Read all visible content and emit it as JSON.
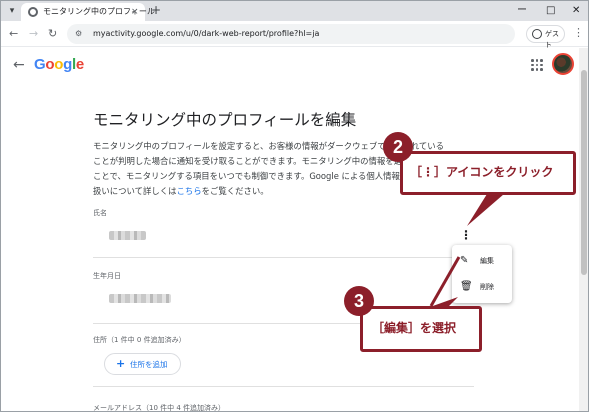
{
  "browser": {
    "tab_title": "モニタリング中のプロフィール",
    "tab_close": "×",
    "new_tab": "+",
    "url": "myactivity.google.com/u/0/dark-web-report/profile?hl=ja",
    "guest_label": "ゲスト",
    "window_controls": [
      "ー",
      "□",
      "✕"
    ]
  },
  "header": {
    "logo_letters": [
      {
        "ch": "G",
        "color": "#4285f4"
      },
      {
        "ch": "o",
        "color": "#ea4335"
      },
      {
        "ch": "o",
        "color": "#fbbc05"
      },
      {
        "ch": "g",
        "color": "#4285f4"
      },
      {
        "ch": "l",
        "color": "#34a853"
      },
      {
        "ch": "e",
        "color": "#ea4335"
      }
    ]
  },
  "main": {
    "title": "モニタリング中のプロフィールを編集",
    "description_lines": [
      "モニタリング中のプロフィールを設定すると、お客様の情報がダークウェブで公開されている",
      "ことが判明した場合に通知を受け取ることができます。モニタリング中の情報を選択する",
      "ことで、モニタリングする項目をいつでも制御できます。Google による個人情報の取り",
      "扱いについて詳しくは"
    ],
    "description_link": "こちら",
    "description_tail": "をご覧ください。",
    "fields": {
      "name_label": "氏名",
      "birthday_label": "生年月日",
      "address_label": "住所（1 件中 0 件追加済み）",
      "add_address_label": "住所を追加",
      "email_label": "メールアドレス（10 件中 4 件追加済み）"
    }
  },
  "context_menu": {
    "edit_label": "編集",
    "delete_label": "削除"
  },
  "annotations": {
    "step2_number": "2",
    "step2_text": "［⋮］アイコンをクリック",
    "step3_number": "3",
    "step3_text": "［編集］を選択",
    "color": "#8c1f2a"
  }
}
